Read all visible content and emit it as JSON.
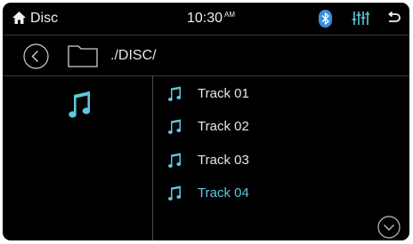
{
  "status_bar": {
    "title": "Disc",
    "time": "10:30",
    "ampm": "AM",
    "home_icon": "home-icon",
    "bluetooth_icon": "bluetooth-icon",
    "equalizer_icon": "equalizer-icon",
    "return_icon": "return-icon"
  },
  "path_bar": {
    "back_icon": "back-circle-icon",
    "folder_icon": "folder-icon",
    "path": "./DISC/"
  },
  "category": {
    "icon": "music-note-icon"
  },
  "tracks": [
    {
      "label": "Track 01",
      "active": false
    },
    {
      "label": "Track 02",
      "active": false
    },
    {
      "label": "Track 03",
      "active": false
    },
    {
      "label": "Track 04",
      "active": true
    }
  ],
  "scroll": {
    "icon": "chevron-down-circle-icon"
  },
  "colors": {
    "accent": "#5ec8dc",
    "bluetooth": "#3b8ee0",
    "background": "#000000",
    "text": "#e6e6e6"
  }
}
